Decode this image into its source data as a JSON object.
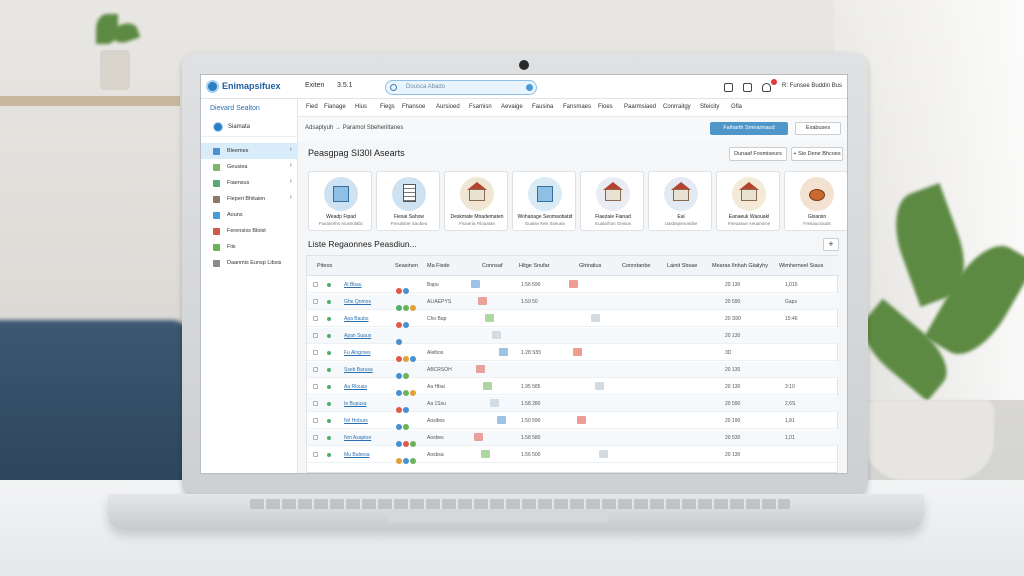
{
  "app": {
    "brand": "Enimapsifuex",
    "user_name": "Exiten",
    "user_id": "3.5.1",
    "header_user_label": "R: Funsee Buddin Bus",
    "search_placeholder": "Dousca Abado"
  },
  "sidebar": {
    "heading": "Dievard Sealton",
    "profile_label": "Siamata",
    "items": [
      {
        "label": "Bleemes",
        "active": true,
        "chevron": "›",
        "color": "#4a8fd0"
      },
      {
        "label": "Geusiea",
        "active": false,
        "chevron": "›",
        "color": "#7bb56a"
      },
      {
        "label": "Fiaensus",
        "active": false,
        "chevron": "›",
        "color": "#5aa87a"
      },
      {
        "label": "Fleperi Bhitaien",
        "active": false,
        "chevron": "›",
        "color": "#8a7a6a"
      },
      {
        "label": "Aouns",
        "active": false,
        "chevron": "",
        "color": "#4a9ad8"
      },
      {
        "label": "Ferensixs Bloist",
        "active": false,
        "chevron": "",
        "color": "#d05a4a"
      },
      {
        "label": "Fiis",
        "active": false,
        "chevron": "",
        "color": "#69b25a"
      },
      {
        "label": "Daanmis Eunsp Libsis",
        "active": false,
        "chevron": "",
        "color": "#8a8a8a"
      }
    ]
  },
  "nav": {
    "tabs": [
      "Fied",
      "Fianage",
      "Hius",
      "Fiegs",
      "Fhansoe",
      "Aursioed",
      "Fsamisn",
      "Aevaige",
      "Fausina",
      "Fansmaes",
      "Fioes",
      "Paarmsiaed",
      "Conrraitgy",
      "Sfeicity",
      "Gfla"
    ]
  },
  "breadcrumb": {
    "text": "Adsaptyuh  →  Paramol Sbeheriltanes",
    "primary_button": "Faiharth Smirarinaud",
    "secondary_button": "Exabuses"
  },
  "section": {
    "title": "Peasgpag SI30I Asearts",
    "btn_one": "Dunaaf Fosmiseurs",
    "btn_two": "+ Sio Dene Bhcoes"
  },
  "cards": [
    {
      "title": "Weadp Fipad",
      "sub": "Fusanrehs Aiosnolabc",
      "bg": "#cfe2f1",
      "type": "building"
    },
    {
      "title": "Fiesai Sahow",
      "sub": "Fenulstne Saobeu",
      "bg": "#cfe2f1",
      "type": "doc"
    },
    {
      "title": "Deskmate Moadematen",
      "sub": "Fiuseria Filouaste",
      "bg": "#efe7d3",
      "type": "house"
    },
    {
      "title": "Wohanage Seomaobatid",
      "sub": "Euaise Nes Sseuea",
      "bg": "#d9ecf6",
      "type": "building"
    },
    {
      "title": "Fiaezaie Fianad",
      "sub": "Euaiarhon Geisus",
      "bg": "#e9edf3",
      "type": "house"
    },
    {
      "title": "Eal",
      "sub": "Uasbepenoedse",
      "bg": "#e3eaf3",
      "type": "house"
    },
    {
      "title": "Eanaeuk Waouakl",
      "sub": "Feeuasue Aeuamiine",
      "bg": "#f4ead8",
      "type": "house"
    },
    {
      "title": "Gixarsin",
      "sub": "Fresaucrauds",
      "bg": "#f3e2d2",
      "type": "hen"
    }
  ],
  "list": {
    "title": "Liste Regaonnes Peasdiun...",
    "add_label": "+",
    "headers": [
      "Piteos",
      "Seasinen",
      "Ma Fisde",
      "Connsaf",
      "Hitge Snufar",
      "Ghtratius",
      "Conrstanbe",
      "Lainit Sbsae",
      "Mearas Ilnhah Glaiiyhy",
      "Wimhemeel Siaus"
    ],
    "rows": [
      {
        "link": "Al Bbau",
        "chips": [
          "#e05a4a",
          "#4a8fd0"
        ],
        "code": "Bapu",
        "val": "1.56 590",
        "num": "20  130",
        "tail": "1,015",
        "dot": "#4fae6a",
        "alt": false
      },
      {
        "link": "Ghe Qnmos",
        "chips": [
          "#4fae6a",
          "#6bb35a",
          "#e0a03a"
        ],
        "code": "ALIAEPYS",
        "val": "1.59 50",
        "num": "20  590",
        "tail": "Gaps",
        "dot": "#4fae6a",
        "alt": true
      },
      {
        "link": "Apa Baubs",
        "chips": [
          "#e05a4a",
          "#4a8fd0"
        ],
        "code": "Cho Bap",
        "val": "",
        "num": "20  S90",
        "tail": "15:46",
        "dot": "#4fae6a",
        "alt": false
      },
      {
        "link": "Apan Suaus",
        "chips": [
          "#4a8fd0"
        ],
        "code": "",
        "val": "",
        "num": "20  130",
        "tail": "",
        "dot": "#4fae6a",
        "alt": true
      },
      {
        "link": "Fu Alogroes",
        "chips": [
          "#e05a4a",
          "#e0a03a",
          "#4a8fd0"
        ],
        "code": "Alelbos",
        "val": "1.28 S55",
        "num": "3D",
        "tail": "",
        "dot": "#4fae6a",
        "alt": false
      },
      {
        "link": "Sseb Barusa",
        "chips": [
          "#4a8fd0",
          "#6bb35a"
        ],
        "code": "ABCRSOH",
        "val": "",
        "num": "20  130",
        "tail": "",
        "dot": "#4fae6a",
        "alt": true
      },
      {
        "link": "Aa Rlouas",
        "chips": [
          "#4a8fd0",
          "#6bb35a",
          "#e0a03a"
        ],
        "code": "Aa Hbai",
        "val": "1.95 585",
        "num": "20  130",
        "tail": "3:10",
        "dot": "#4fae6a",
        "alt": false
      },
      {
        "link": "Ie Bupusa",
        "chips": [
          "#e05a4a",
          "#4a8fd0"
        ],
        "code": "Aa 1Ssu",
        "val": "1.58 280",
        "num": "20  590",
        "tail": "2,6S",
        "dot": "#4fae6a",
        "alt": true
      },
      {
        "link": "Nrl Hnburs",
        "chips": [
          "#4a8fd0",
          "#6bb35a"
        ],
        "code": "Aoslbos",
        "val": "1.50 590",
        "num": "20  190",
        "tail": "1,81",
        "dot": "#4fae6a",
        "alt": false
      },
      {
        "link": "Nm Asaptoo",
        "chips": [
          "#4a8fd0",
          "#e05a4a",
          "#6bb35a"
        ],
        "code": "Aosbes",
        "val": "1.58 580",
        "num": "20  530",
        "tail": "1,01",
        "dot": "#4fae6a",
        "alt": true
      },
      {
        "link": "Mu Bubeoa",
        "chips": [
          "#e0a03a",
          "#4a8fd0",
          "#6bb35a"
        ],
        "code": "Aosbsa",
        "val": "1.56 500",
        "num": "20  130",
        "tail": "",
        "dot": "#4fae6a",
        "alt": false
      }
    ]
  },
  "colors": {
    "accent": "#4f97c9",
    "brand": "#2d7fc4",
    "notification": "#e03a3a"
  }
}
